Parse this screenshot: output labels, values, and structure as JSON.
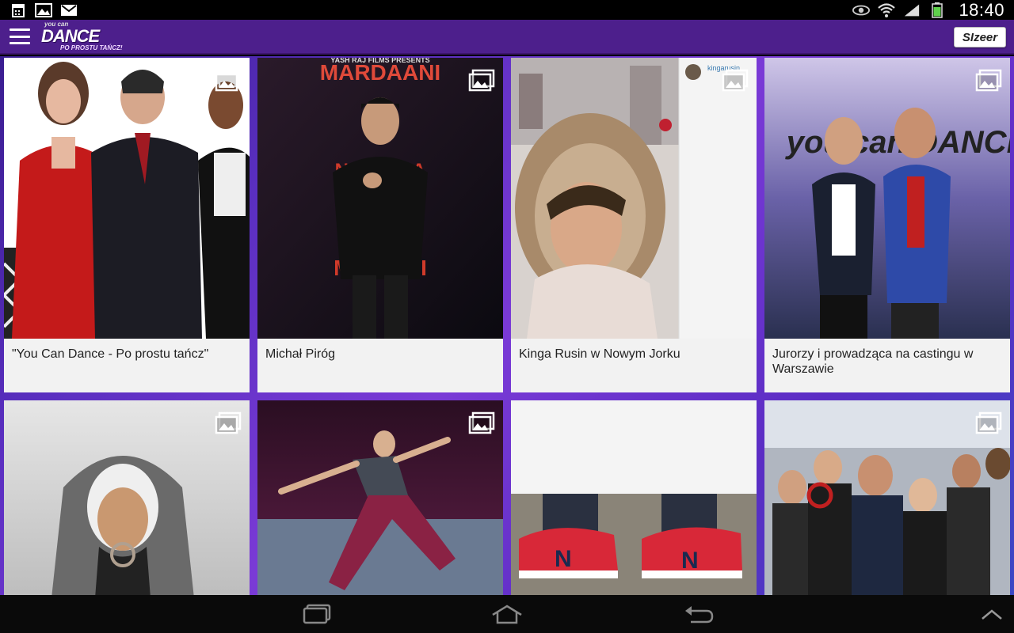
{
  "status_bar": {
    "time": "18:40",
    "left_icons": [
      "calendar-icon",
      "image-icon",
      "gmail-icon"
    ],
    "right_icons": [
      "eye-icon",
      "wifi-icon",
      "signal-icon",
      "battery-icon"
    ]
  },
  "app_bar": {
    "logo_line1": "you can",
    "logo_line2": "DANCE",
    "logo_line3": "PO PROSTU TAŃCZ!",
    "sponsor_label": "SIzeer"
  },
  "cards": [
    {
      "caption": "\"You Can Dance - Po prostu tańcz\"",
      "type_icon": "gallery-icon"
    },
    {
      "caption": "Michał Piróg",
      "type_icon": "gallery-icon"
    },
    {
      "caption": "Kinga Rusin w Nowym Jorku",
      "type_icon": "gallery-icon",
      "inset_username": "kingarusin"
    },
    {
      "caption": "Jurorzy i prowadząca na castingu w Warszawie",
      "type_icon": "gallery-icon"
    },
    {
      "caption": "",
      "type_icon": "gallery-icon"
    },
    {
      "caption": "",
      "type_icon": "gallery-icon"
    },
    {
      "caption": "",
      "type_icon": ""
    },
    {
      "caption": "",
      "type_icon": "gallery-icon"
    }
  ],
  "photo_text": {
    "card2_title": "MARDAANI",
    "card2_sub": "YASH RAJ FILMS PRESENTS",
    "card4_logo": "you can DANCE"
  },
  "nav_bar": {
    "buttons": [
      "recent-apps-icon",
      "home-icon",
      "back-icon",
      "chevron-up-icon"
    ]
  },
  "colors": {
    "app_bar": "#4d1f8c",
    "content_gradient_start": "#3a1d90",
    "content_gradient_end": "#3b48c4",
    "card_background": "#f2f2f2"
  }
}
